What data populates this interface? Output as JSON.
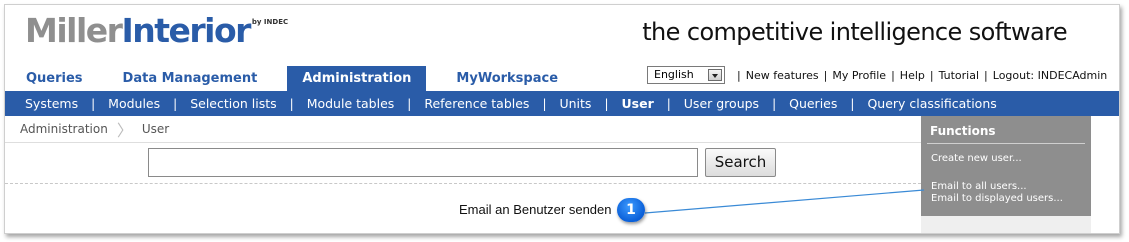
{
  "header": {
    "logo_part1": "Miller",
    "logo_part2": "Interior",
    "logo_byline": "by INDEC",
    "tagline": "the competitive intelligence software"
  },
  "main_tabs": [
    {
      "label": "Queries",
      "active": false
    },
    {
      "label": "Data Management",
      "active": false
    },
    {
      "label": "Administration",
      "active": true
    },
    {
      "label": "MyWorkspace",
      "active": false
    }
  ],
  "utility": {
    "language_selected": "English",
    "links": [
      "New features",
      "My Profile",
      "Help",
      "Tutorial",
      "Logout: INDECAdmin"
    ]
  },
  "sub_nav": {
    "items": [
      "Systems",
      "Modules",
      "Selection lists",
      "Module tables",
      "Reference tables",
      "Units",
      "User",
      "User groups",
      "Queries",
      "Query classifications"
    ],
    "active": "User"
  },
  "breadcrumb": [
    "Administration",
    "User"
  ],
  "search": {
    "value": "",
    "button_label": "Search"
  },
  "functions_panel": {
    "title": "Functions",
    "links": [
      "Create new user...",
      "Email to all users...",
      "Email to displayed users..."
    ]
  },
  "callout": {
    "number": "1",
    "text": "Email an Benutzer senden"
  },
  "colors": {
    "brand_blue": "#2a5ca8",
    "logo_gray": "#8f8f8f",
    "panel_gray": "#8e8e8e",
    "callout_blue": "#0a5fd8"
  }
}
